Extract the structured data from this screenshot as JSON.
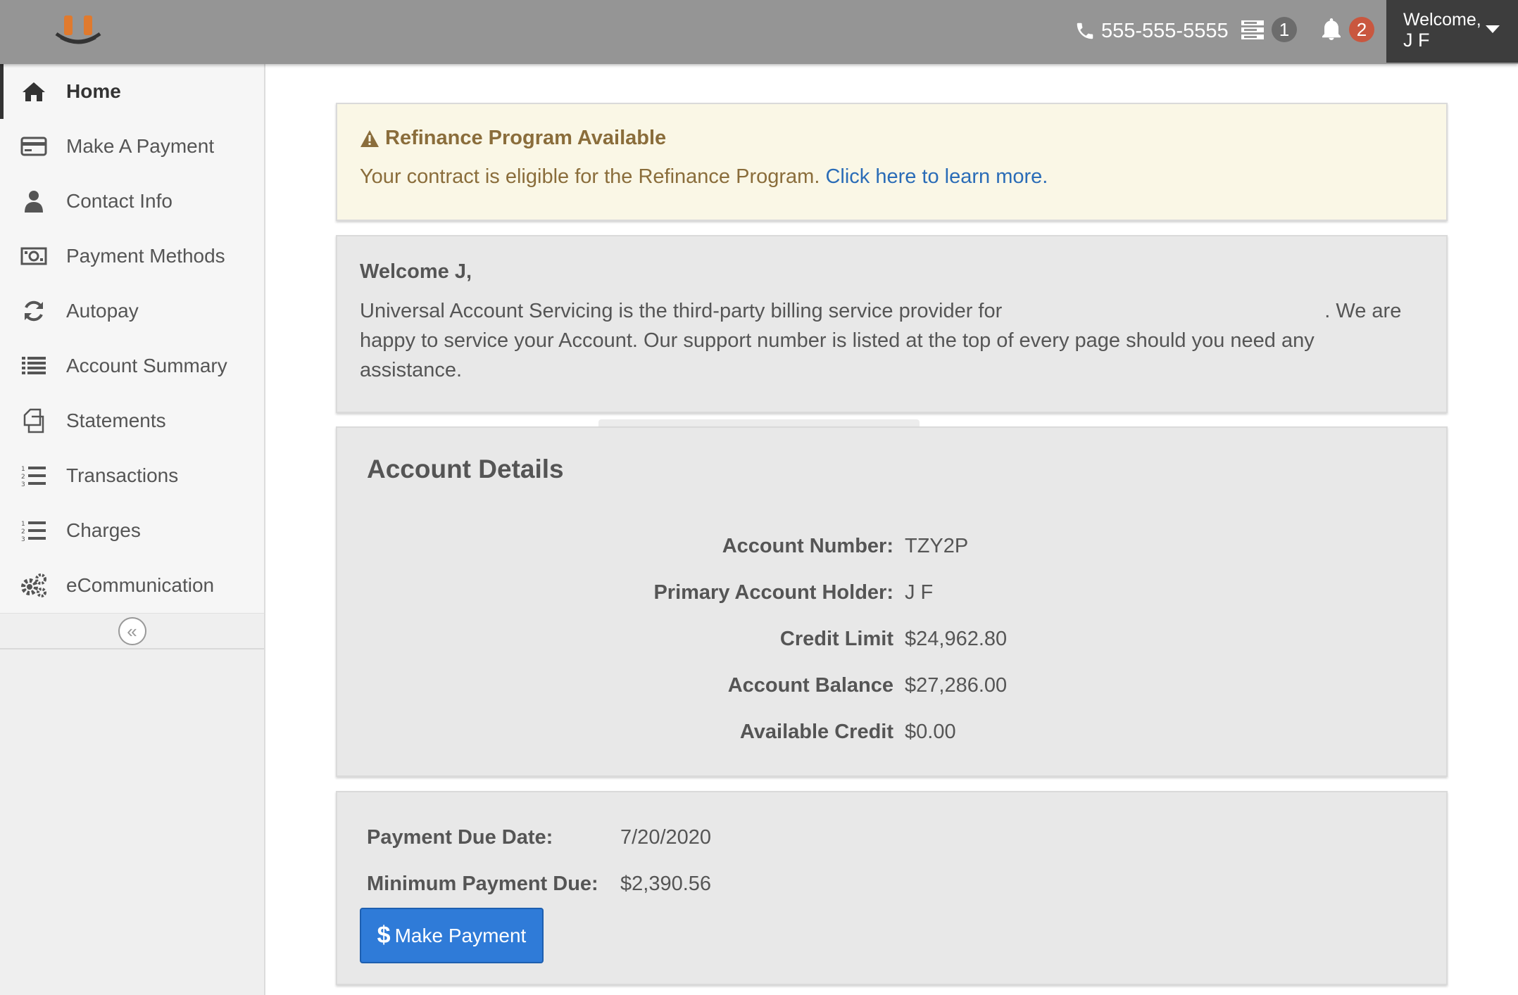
{
  "header": {
    "phone": "555-555-5555",
    "messages_count": "1",
    "notifications_count": "2",
    "welcome_label": "Welcome,",
    "user_name": "J F"
  },
  "sidebar": {
    "items": [
      {
        "label": "Home",
        "icon": "home-icon",
        "active": true
      },
      {
        "label": "Make A Payment",
        "icon": "credit-card-icon"
      },
      {
        "label": "Contact Info",
        "icon": "user-icon"
      },
      {
        "label": "Payment Methods",
        "icon": "money-icon"
      },
      {
        "label": "Autopay",
        "icon": "refresh-icon"
      },
      {
        "label": "Account Summary",
        "icon": "list-icon"
      },
      {
        "label": "Statements",
        "icon": "copy-icon"
      },
      {
        "label": "Transactions",
        "icon": "ordered-list-icon"
      },
      {
        "label": "Charges",
        "icon": "ordered-list-icon"
      },
      {
        "label": "eCommunication",
        "icon": "gears-icon"
      }
    ],
    "collapse_glyph": "«"
  },
  "alert": {
    "title": "Refinance Program Available",
    "text": "Your contract is eligible for the Refinance Program. ",
    "link": "Click here to learn more."
  },
  "welcome": {
    "heading": "Welcome J,",
    "line1a": "Universal Account Servicing is the third-party billing service provider for",
    "line1b": ". We are",
    "line2": "happy to service your Account. Our support number is listed at the top of every page should you need any",
    "line3": "assistance."
  },
  "details": {
    "title": "Account Details",
    "rows": [
      {
        "label": "Account Number:",
        "value": "TZY2P"
      },
      {
        "label": "Primary Account Holder:",
        "value": "J F"
      },
      {
        "label": "Credit Limit",
        "value": "$24,962.80"
      },
      {
        "label": "Account Balance",
        "value": "$27,286.00"
      },
      {
        "label": "Available Credit",
        "value": "$0.00"
      }
    ]
  },
  "payment": {
    "due_date_label": "Payment Due Date:",
    "due_date_value": "7/20/2020",
    "min_due_label": "Minimum Payment Due:",
    "min_due_value": "$2,390.56",
    "button_label": "Make Payment"
  },
  "colors": {
    "topbar": "#959595",
    "user_box": "#3d3d3d",
    "alert_bg": "#faf7e6",
    "alert_text": "#8a6d3b",
    "link": "#2a6cb7",
    "button": "#2f7bd8",
    "badge_red": "#c9573f"
  }
}
